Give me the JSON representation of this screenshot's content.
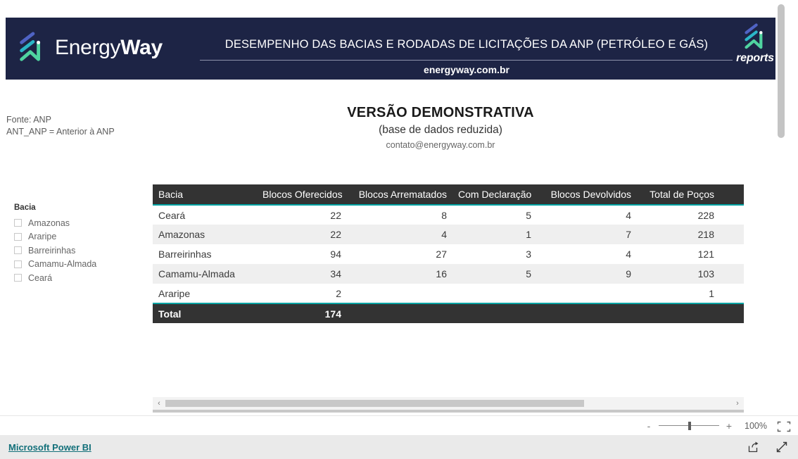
{
  "banner": {
    "brand_name_light": "Energy",
    "brand_name_bold": "Way",
    "title": "DESEMPENHO DAS BACIAS E RODADAS DE LICITAÇÕES DA ANP (PETRÓLEO E GÁS)",
    "subtitle": "energyway.com.br",
    "reports_label": "reports",
    "background_color": "#1d2445",
    "logo_icon": "energyway-chevron-logo",
    "reports_logo_icon": "energyway-chevron-logo"
  },
  "notes": {
    "line1": "Fonte: ANP",
    "line2": "ANT_ANP = Anterior à ANP"
  },
  "slicer": {
    "title": "Bacia",
    "items": [
      {
        "label": "Amazonas",
        "checked": false
      },
      {
        "label": "Araripe",
        "checked": false
      },
      {
        "label": "Barreirinhas",
        "checked": false
      },
      {
        "label": "Camamu-Almada",
        "checked": false
      },
      {
        "label": "Ceará",
        "checked": false
      }
    ]
  },
  "center": {
    "title": "VERSÃO DEMONSTRATIVA",
    "subtitle": "(base de dados reduzida)",
    "email": "contato@energyway.com.br"
  },
  "table": {
    "header_bg": "#333333",
    "accent_color": "#00a3a3",
    "columns": [
      "Bacia",
      "Blocos Oferecidos",
      "Blocos Arrematados",
      "Com Declaração",
      "Blocos Devolvidos",
      "Total de Poços",
      ""
    ],
    "rows": [
      {
        "cells": [
          "Ceará",
          "22",
          "8",
          "5",
          "4",
          "228",
          ""
        ]
      },
      {
        "cells": [
          "Amazonas",
          "22",
          "4",
          "1",
          "7",
          "218",
          ""
        ]
      },
      {
        "cells": [
          "Barreirinhas",
          "94",
          "27",
          "3",
          "4",
          "121",
          ""
        ]
      },
      {
        "cells": [
          "Camamu-Almada",
          "34",
          "16",
          "5",
          "9",
          "103",
          ""
        ]
      },
      {
        "cells": [
          "Araripe",
          "2",
          "",
          "",
          "",
          "1",
          ""
        ]
      }
    ],
    "total_row": {
      "cells": [
        "Total",
        "174",
        "",
        "",
        "",
        "",
        ""
      ]
    }
  },
  "scrollbars": {
    "left_arrow_icon": "chevron-left-icon",
    "right_arrow_icon": "chevron-right-icon"
  },
  "zoombar": {
    "minus_label": "-",
    "plus_label": "+",
    "percent": "100%",
    "fit_icon": "fit-to-page-icon"
  },
  "footer": {
    "link_label": "Microsoft Power BI",
    "share_icon": "share-icon",
    "fullscreen_icon": "fullscreen-icon"
  }
}
